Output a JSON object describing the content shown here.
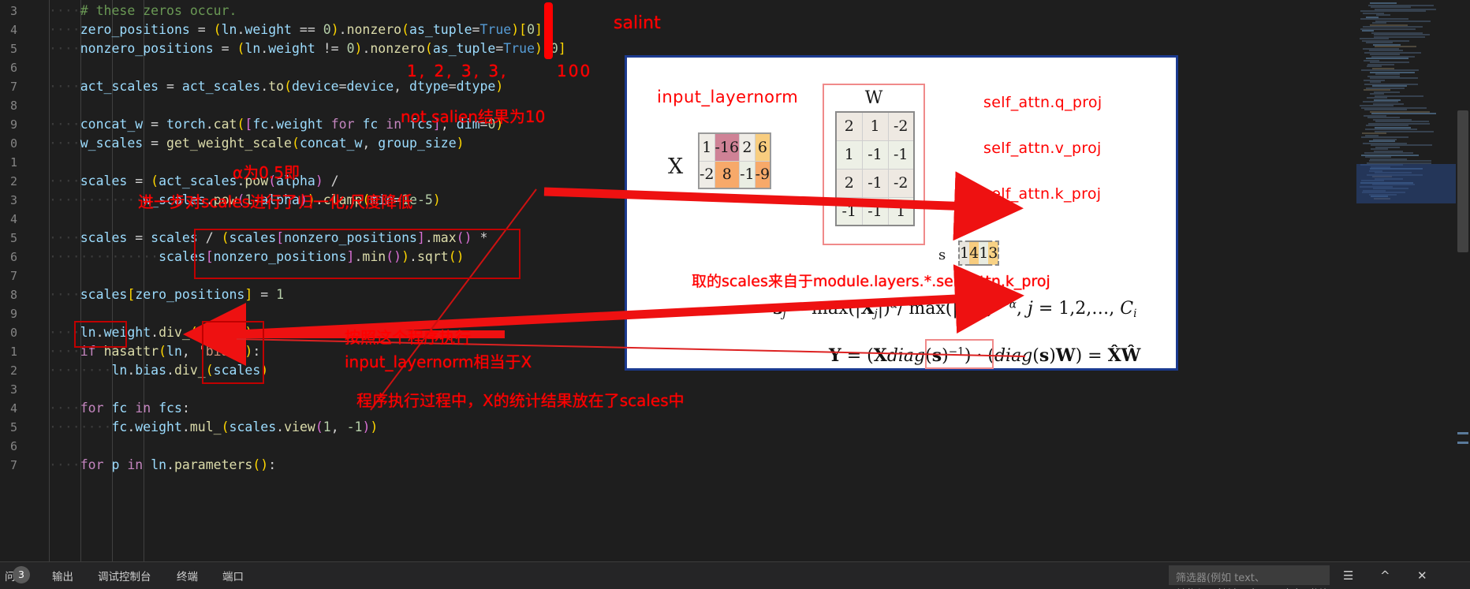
{
  "editor": {
    "language": "python",
    "line_numbers": [
      "3",
      "4",
      "5",
      "6",
      "7",
      "8",
      "9",
      "0",
      "1",
      "2",
      "3",
      "4",
      "5",
      "6",
      "7",
      "8",
      "9",
      "0",
      "1",
      "2",
      "3",
      "4",
      "5",
      "6",
      "7"
    ],
    "lines": [
      {
        "indent": 4,
        "tokens": [
          {
            "t": "# these zeros occur.",
            "c": "c-com"
          }
        ]
      },
      {
        "indent": 4,
        "tokens": [
          {
            "t": "zero_positions",
            "c": "c-var"
          },
          {
            "t": " = ",
            "c": "c-op"
          },
          {
            "t": "(",
            "c": "c-par1"
          },
          {
            "t": "ln",
            "c": "c-var"
          },
          {
            "t": ".",
            "c": "c-op"
          },
          {
            "t": "weight",
            "c": "c-var"
          },
          {
            "t": " == ",
            "c": "c-op"
          },
          {
            "t": "0",
            "c": "c-num"
          },
          {
            "t": ")",
            "c": "c-par1"
          },
          {
            "t": ".",
            "c": "c-op"
          },
          {
            "t": "nonzero",
            "c": "c-fn"
          },
          {
            "t": "(",
            "c": "c-par1"
          },
          {
            "t": "as_tuple",
            "c": "c-var"
          },
          {
            "t": "=",
            "c": "c-op"
          },
          {
            "t": "True",
            "c": "c-kw2"
          },
          {
            "t": ")",
            "c": "c-par1"
          },
          {
            "t": "[",
            "c": "c-par1"
          },
          {
            "t": "0",
            "c": "c-num"
          },
          {
            "t": "]",
            "c": "c-par1"
          }
        ]
      },
      {
        "indent": 4,
        "tokens": [
          {
            "t": "nonzero_positions",
            "c": "c-var"
          },
          {
            "t": " = ",
            "c": "c-op"
          },
          {
            "t": "(",
            "c": "c-par1"
          },
          {
            "t": "ln",
            "c": "c-var"
          },
          {
            "t": ".",
            "c": "c-op"
          },
          {
            "t": "weight",
            "c": "c-var"
          },
          {
            "t": " != ",
            "c": "c-op"
          },
          {
            "t": "0",
            "c": "c-num"
          },
          {
            "t": ")",
            "c": "c-par1"
          },
          {
            "t": ".",
            "c": "c-op"
          },
          {
            "t": "nonzero",
            "c": "c-fn"
          },
          {
            "t": "(",
            "c": "c-par1"
          },
          {
            "t": "as_tuple",
            "c": "c-var"
          },
          {
            "t": "=",
            "c": "c-op"
          },
          {
            "t": "True",
            "c": "c-kw2"
          },
          {
            "t": ")",
            "c": "c-par1"
          },
          {
            "t": "[",
            "c": "c-par1"
          },
          {
            "t": "0",
            "c": "c-num"
          },
          {
            "t": "]",
            "c": "c-par1"
          }
        ]
      },
      {
        "indent": 0,
        "tokens": []
      },
      {
        "indent": 4,
        "tokens": [
          {
            "t": "act_scales",
            "c": "c-var"
          },
          {
            "t": " = ",
            "c": "c-op"
          },
          {
            "t": "act_scales",
            "c": "c-var"
          },
          {
            "t": ".",
            "c": "c-op"
          },
          {
            "t": "to",
            "c": "c-fn"
          },
          {
            "t": "(",
            "c": "c-par1"
          },
          {
            "t": "device",
            "c": "c-var"
          },
          {
            "t": "=",
            "c": "c-op"
          },
          {
            "t": "device",
            "c": "c-var"
          },
          {
            "t": ", ",
            "c": "c-op"
          },
          {
            "t": "dtype",
            "c": "c-var"
          },
          {
            "t": "=",
            "c": "c-op"
          },
          {
            "t": "dtype",
            "c": "c-var"
          },
          {
            "t": ")",
            "c": "c-par1"
          }
        ]
      },
      {
        "indent": 0,
        "tokens": []
      },
      {
        "indent": 4,
        "tokens": [
          {
            "t": "concat_w",
            "c": "c-var"
          },
          {
            "t": " = ",
            "c": "c-op"
          },
          {
            "t": "torch",
            "c": "c-var"
          },
          {
            "t": ".",
            "c": "c-op"
          },
          {
            "t": "cat",
            "c": "c-fn"
          },
          {
            "t": "(",
            "c": "c-par1"
          },
          {
            "t": "[",
            "c": "c-par2"
          },
          {
            "t": "fc",
            "c": "c-var"
          },
          {
            "t": ".",
            "c": "c-op"
          },
          {
            "t": "weight",
            "c": "c-var"
          },
          {
            "t": " ",
            "c": "c-op"
          },
          {
            "t": "for",
            "c": "c-kw"
          },
          {
            "t": " ",
            "c": "c-op"
          },
          {
            "t": "fc",
            "c": "c-var"
          },
          {
            "t": " ",
            "c": "c-op"
          },
          {
            "t": "in",
            "c": "c-kw"
          },
          {
            "t": " ",
            "c": "c-op"
          },
          {
            "t": "fcs",
            "c": "c-var"
          },
          {
            "t": "]",
            "c": "c-par2"
          },
          {
            "t": ", ",
            "c": "c-op"
          },
          {
            "t": "dim",
            "c": "c-var"
          },
          {
            "t": "=",
            "c": "c-op"
          },
          {
            "t": "0",
            "c": "c-num"
          },
          {
            "t": ")",
            "c": "c-par1"
          }
        ]
      },
      {
        "indent": 4,
        "tokens": [
          {
            "t": "w_scales",
            "c": "c-var"
          },
          {
            "t": " = ",
            "c": "c-op"
          },
          {
            "t": "get_weight_scale",
            "c": "c-fn"
          },
          {
            "t": "(",
            "c": "c-par1"
          },
          {
            "t": "concat_w",
            "c": "c-var"
          },
          {
            "t": ", ",
            "c": "c-op"
          },
          {
            "t": "group_size",
            "c": "c-var"
          },
          {
            "t": ")",
            "c": "c-par1"
          }
        ]
      },
      {
        "indent": 0,
        "tokens": []
      },
      {
        "indent": 4,
        "tokens": [
          {
            "t": "scales",
            "c": "c-var"
          },
          {
            "t": " = ",
            "c": "c-op"
          },
          {
            "t": "(",
            "c": "c-par1"
          },
          {
            "t": "act_scales",
            "c": "c-var"
          },
          {
            "t": ".",
            "c": "c-op"
          },
          {
            "t": "pow",
            "c": "c-fn"
          },
          {
            "t": "(",
            "c": "c-par2"
          },
          {
            "t": "alpha",
            "c": "c-var"
          },
          {
            "t": ")",
            "c": "c-par2"
          },
          {
            "t": " /",
            "c": "c-op"
          }
        ]
      },
      {
        "indent": 12,
        "tokens": [
          {
            "t": "w_scales",
            "c": "c-var"
          },
          {
            "t": ".",
            "c": "c-op"
          },
          {
            "t": "pow",
            "c": "c-fn"
          },
          {
            "t": "(",
            "c": "c-par2"
          },
          {
            "t": "1",
            "c": "c-num"
          },
          {
            "t": "-",
            "c": "c-op"
          },
          {
            "t": "alpha",
            "c": "c-var"
          },
          {
            "t": ")",
            "c": "c-par2"
          },
          {
            "t": ")",
            "c": "c-par1"
          },
          {
            "t": ".",
            "c": "c-op"
          },
          {
            "t": "clamp",
            "c": "c-fn"
          },
          {
            "t": "(",
            "c": "c-par1"
          },
          {
            "t": "min",
            "c": "c-var"
          },
          {
            "t": "=",
            "c": "c-op"
          },
          {
            "t": "1e-5",
            "c": "c-num"
          },
          {
            "t": ")",
            "c": "c-par1"
          }
        ]
      },
      {
        "indent": 0,
        "tokens": []
      },
      {
        "indent": 4,
        "tokens": [
          {
            "t": "scales",
            "c": "c-var"
          },
          {
            "t": " = ",
            "c": "c-op"
          },
          {
            "t": "scales",
            "c": "c-var"
          },
          {
            "t": " / ",
            "c": "c-op"
          },
          {
            "t": "(",
            "c": "c-par1"
          },
          {
            "t": "scales",
            "c": "c-var"
          },
          {
            "t": "[",
            "c": "c-par2"
          },
          {
            "t": "nonzero_positions",
            "c": "c-var"
          },
          {
            "t": "]",
            "c": "c-par2"
          },
          {
            "t": ".",
            "c": "c-op"
          },
          {
            "t": "max",
            "c": "c-fn"
          },
          {
            "t": "(",
            "c": "c-par2"
          },
          {
            "t": ")",
            "c": "c-par2"
          },
          {
            "t": " *",
            "c": "c-op"
          }
        ]
      },
      {
        "indent": 14,
        "tokens": [
          {
            "t": "scales",
            "c": "c-var"
          },
          {
            "t": "[",
            "c": "c-par2"
          },
          {
            "t": "nonzero_positions",
            "c": "c-var"
          },
          {
            "t": "]",
            "c": "c-par2"
          },
          {
            "t": ".",
            "c": "c-op"
          },
          {
            "t": "min",
            "c": "c-fn"
          },
          {
            "t": "(",
            "c": "c-par2"
          },
          {
            "t": ")",
            "c": "c-par2"
          },
          {
            "t": ")",
            "c": "c-par1"
          },
          {
            "t": ".",
            "c": "c-op"
          },
          {
            "t": "sqrt",
            "c": "c-fn"
          },
          {
            "t": "(",
            "c": "c-par1"
          },
          {
            "t": ")",
            "c": "c-par1"
          }
        ]
      },
      {
        "indent": 0,
        "tokens": []
      },
      {
        "indent": 4,
        "tokens": [
          {
            "t": "scales",
            "c": "c-var"
          },
          {
            "t": "[",
            "c": "c-par1"
          },
          {
            "t": "zero_positions",
            "c": "c-var"
          },
          {
            "t": "]",
            "c": "c-par1"
          },
          {
            "t": " = ",
            "c": "c-op"
          },
          {
            "t": "1",
            "c": "c-num"
          }
        ]
      },
      {
        "indent": 0,
        "tokens": []
      },
      {
        "indent": 4,
        "tokens": [
          {
            "t": "ln",
            "c": "c-var"
          },
          {
            "t": ".",
            "c": "c-op"
          },
          {
            "t": "weight",
            "c": "c-var"
          },
          {
            "t": ".",
            "c": "c-op"
          },
          {
            "t": "div_",
            "c": "c-fn"
          },
          {
            "t": "(",
            "c": "c-par1"
          },
          {
            "t": "scales",
            "c": "c-var"
          },
          {
            "t": ")",
            "c": "c-par1"
          }
        ]
      },
      {
        "indent": 4,
        "tokens": [
          {
            "t": "if",
            "c": "c-kw"
          },
          {
            "t": " ",
            "c": "c-op"
          },
          {
            "t": "hasattr",
            "c": "c-fn"
          },
          {
            "t": "(",
            "c": "c-par1"
          },
          {
            "t": "ln",
            "c": "c-var"
          },
          {
            "t": ", ",
            "c": "c-op"
          },
          {
            "t": "'bias'",
            "c": "c-str"
          },
          {
            "t": ")",
            "c": "c-par1"
          },
          {
            "t": ":",
            "c": "c-op"
          }
        ]
      },
      {
        "indent": 8,
        "tokens": [
          {
            "t": "ln",
            "c": "c-var"
          },
          {
            "t": ".",
            "c": "c-op"
          },
          {
            "t": "bias",
            "c": "c-var"
          },
          {
            "t": ".",
            "c": "c-op"
          },
          {
            "t": "div_",
            "c": "c-fn"
          },
          {
            "t": "(",
            "c": "c-par1"
          },
          {
            "t": "scales",
            "c": "c-var"
          },
          {
            "t": ")",
            "c": "c-par1"
          }
        ]
      },
      {
        "indent": 0,
        "tokens": []
      },
      {
        "indent": 4,
        "tokens": [
          {
            "t": "for",
            "c": "c-kw"
          },
          {
            "t": " ",
            "c": "c-op"
          },
          {
            "t": "fc",
            "c": "c-var"
          },
          {
            "t": " ",
            "c": "c-op"
          },
          {
            "t": "in",
            "c": "c-kw"
          },
          {
            "t": " ",
            "c": "c-op"
          },
          {
            "t": "fcs",
            "c": "c-var"
          },
          {
            "t": ":",
            "c": "c-op"
          }
        ]
      },
      {
        "indent": 8,
        "tokens": [
          {
            "t": "fc",
            "c": "c-var"
          },
          {
            "t": ".",
            "c": "c-op"
          },
          {
            "t": "weight",
            "c": "c-var"
          },
          {
            "t": ".",
            "c": "c-op"
          },
          {
            "t": "mul_",
            "c": "c-fn"
          },
          {
            "t": "(",
            "c": "c-par1"
          },
          {
            "t": "scales",
            "c": "c-var"
          },
          {
            "t": ".",
            "c": "c-op"
          },
          {
            "t": "view",
            "c": "c-fn"
          },
          {
            "t": "(",
            "c": "c-par2"
          },
          {
            "t": "1",
            "c": "c-num"
          },
          {
            "t": ", ",
            "c": "c-op"
          },
          {
            "t": "-1",
            "c": "c-num"
          },
          {
            "t": ")",
            "c": "c-par2"
          },
          {
            "t": ")",
            "c": "c-par1"
          }
        ]
      },
      {
        "indent": 0,
        "tokens": []
      },
      {
        "indent": 4,
        "tokens": [
          {
            "t": "for",
            "c": "c-kw"
          },
          {
            "t": " ",
            "c": "c-op"
          },
          {
            "t": "p",
            "c": "c-var"
          },
          {
            "t": " ",
            "c": "c-op"
          },
          {
            "t": "in",
            "c": "c-kw"
          },
          {
            "t": " ",
            "c": "c-op"
          },
          {
            "t": "ln",
            "c": "c-var"
          },
          {
            "t": ".",
            "c": "c-op"
          },
          {
            "t": "parameters",
            "c": "c-fn"
          },
          {
            "t": "(",
            "c": "c-par1"
          },
          {
            "t": ")",
            "c": "c-par1"
          },
          {
            "t": ":",
            "c": "c-op"
          }
        ]
      }
    ]
  },
  "annotations": {
    "salient_title": "salint",
    "numbers_row": "1,  2,  3,  3,",
    "number_100": "100",
    "not_salient": "not salien结果为10",
    "alpha_note": "α为0.5即",
    "normalize_note": "进一步对scales进行了归一化,尺度降低",
    "order_note_1": "按照这个程序执行",
    "order_note_2": "input_layernorm相当于X",
    "bottom_note": "程序执行过程中，X的统计结果放在了scales中",
    "scales_source": "取的scales来自于module.layers.*.self_attn.k_proj"
  },
  "diagram": {
    "input_layernorm_label": "input_layernorm",
    "x_label": "X",
    "x_matrix": [
      [
        "1",
        "-16",
        "2",
        "6"
      ],
      [
        "-2",
        "8",
        "-1",
        "-9"
      ]
    ],
    "x_cell_colors": [
      [
        "#efece6",
        "#cf8296",
        "#efece6",
        "#f8cd7f"
      ],
      [
        "#efece6",
        "#f7a96a",
        "#eaeee3",
        "#f7a96a"
      ]
    ],
    "multiply_symbol": "*",
    "w_label": "W",
    "w_matrix": [
      [
        "2",
        "1",
        "-2"
      ],
      [
        "1",
        "-1",
        "-1"
      ],
      [
        "2",
        "-1",
        "-2"
      ],
      [
        "-1",
        "-1",
        "1"
      ]
    ],
    "w_cell_colors": [
      [
        "#eee9e2",
        "#eee9e2",
        "#eee9e2"
      ],
      [
        "#edf0e6",
        "#edf0e6",
        "#edf0e6"
      ],
      [
        "#eee9e2",
        "#eee9e2",
        "#eee9e2"
      ],
      [
        "#edf0e6",
        "#edf0e6",
        "#edf0e6"
      ]
    ],
    "s_label": "s",
    "s_vector": [
      "1",
      "4",
      "1",
      "3"
    ],
    "s_cell_colors": [
      "#e8e5de",
      "#f7cc7f",
      "#e9ece1",
      "#f8d285"
    ],
    "right_labels": [
      "self_attn.q_proj",
      "self_attn.v_proj",
      "self_attn.k_proj"
    ],
    "formula_s": "sj = max(|Xj|)^α / max(|Wj|)^(1−α), j = 1,2,…, Ci",
    "formula_y": "Y = (X diag(s)^−1) · (diag(s)W) = X̂Ŵ"
  },
  "bottom_panel": {
    "tabs": [
      "问题",
      "输出",
      "调试控制台",
      "终端",
      "端口"
    ],
    "problem_count": "3",
    "filter_placeholder": "筛选器(例如 text、**/*.ts、!**/node_modules/**)",
    "icons": [
      "filter-lines-icon",
      "collapse-icon",
      "close-icon"
    ]
  },
  "colors": {
    "editor_bg": "#1e1e1e",
    "annotation_red": "#ff0000",
    "panel_border_blue": "#1b3a8f",
    "box_red": "#c00000"
  }
}
